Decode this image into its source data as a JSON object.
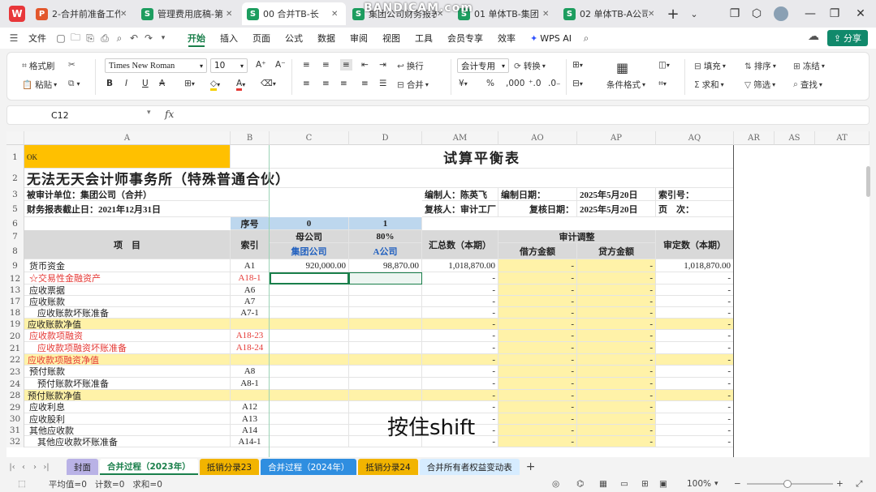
{
  "tabs": [
    {
      "icon": "P",
      "label": "2-合并前准备工作"
    },
    {
      "icon": "S",
      "label": "管理费用底稿-第"
    },
    {
      "icon": "S",
      "label": "00 合并TB-长"
    },
    {
      "icon": "S",
      "label": "集团公司财务报表"
    },
    {
      "icon": "S",
      "label": "01 单体TB-集团"
    },
    {
      "icon": "S",
      "label": "02 单体TB-A公司"
    }
  ],
  "watermark": "BANDICAM.com",
  "menu": [
    "文件",
    "开始",
    "插入",
    "页面",
    "公式",
    "数据",
    "审阅",
    "视图",
    "工具",
    "会员专享",
    "效率",
    "WPS AI"
  ],
  "share_label": "分享",
  "ribbon": {
    "format_painter": "格式刷",
    "paste": "粘贴",
    "font_name": "Times New Roman",
    "font_size": "10",
    "wrap": "换行",
    "merge": "合并",
    "number_format": "会计专用",
    "convert": "转换",
    "cond_format": "条件格式",
    "fill": "填充",
    "sort": "排序",
    "freeze": "冻结",
    "sum": "求和",
    "filter": "筛选",
    "find": "查找"
  },
  "namebox": "C12",
  "fx_label": "fx",
  "columns": [
    "A",
    "B",
    "C",
    "D",
    "AM",
    "AO",
    "AP",
    "AQ",
    "AR",
    "AS",
    "AT"
  ],
  "rows": [
    "1",
    "2",
    "3",
    "5",
    "6",
    "7",
    "8",
    "9",
    "12",
    "13",
    "17",
    "18",
    "19",
    "20",
    "21",
    "22",
    "23",
    "24",
    "28",
    "29",
    "30",
    "31",
    "32"
  ],
  "sheet": {
    "a1": "OK",
    "title": "试算平衡表",
    "firm": "无法无天会计师事务所（特殊普通合伙）",
    "audited_unit": "被审计单位：集团公司（合并）",
    "period": "财务报表截止日：2021年12月31日",
    "preparer": "编制人：陈英飞",
    "prep_date_label": "编制日期：",
    "prep_date": "2025年5月20日",
    "index_no": "索引号：",
    "reviewer": "复核人：审计工厂",
    "review_date_label": "复核日期：",
    "review_date": "2025年5月20日",
    "page_label": "页　次：",
    "seq_label": "序号",
    "seq_c": "0",
    "seq_d": "1",
    "item_header": "项　目",
    "index_header": "索引",
    "parent_label": "母公司",
    "ratio": "80%",
    "group_co": "集团公司",
    "a_co": "A公司",
    "total_label": "汇总数（本期）",
    "adjust_label": "审计调整",
    "debit_label": "借方金额",
    "credit_label": "贷方金额",
    "audited_label": "审定数（本期）"
  },
  "items": [
    {
      "row": "9",
      "name": "货币资金",
      "idx": "A1",
      "c": "920,000.00",
      "d": "98,870.00",
      "am": "1,018,870.00",
      "ao": "-",
      "ap": "-",
      "aq": "1,018,870.00",
      "style": "normal"
    },
    {
      "row": "12",
      "name": "☆交易性金融资产",
      "idx": "A18-1",
      "c": "",
      "d": "",
      "am": "-",
      "ao": "-",
      "ap": "-",
      "aq": "-",
      "style": "red"
    },
    {
      "row": "13",
      "name": "应收票据",
      "idx": "A6",
      "c": "",
      "d": "",
      "am": "-",
      "ao": "-",
      "ap": "-",
      "aq": "-",
      "style": "normal"
    },
    {
      "row": "17",
      "name": "应收账款",
      "idx": "A7",
      "c": "",
      "d": "",
      "am": "-",
      "ao": "-",
      "ap": "-",
      "aq": "-",
      "style": "normal"
    },
    {
      "row": "18",
      "name": "应收账款坏账准备",
      "idx": "A7-1",
      "c": "",
      "d": "",
      "am": "-",
      "ao": "-",
      "ap": "-",
      "aq": "-",
      "style": "indent"
    },
    {
      "row": "19",
      "name": "应收账款净值",
      "idx": "",
      "c": "",
      "d": "",
      "am": "-",
      "ao": "-",
      "ap": "-",
      "aq": "-",
      "style": "yellow"
    },
    {
      "row": "20",
      "name": "应收款项融资",
      "idx": "A18-23",
      "c": "",
      "d": "",
      "am": "-",
      "ao": "-",
      "ap": "-",
      "aq": "-",
      "style": "red"
    },
    {
      "row": "21",
      "name": "应收款项融资坏账准备",
      "idx": "A18-24",
      "c": "",
      "d": "",
      "am": "-",
      "ao": "-",
      "ap": "-",
      "aq": "-",
      "style": "redindent"
    },
    {
      "row": "22",
      "name": "应收款项融资净值",
      "idx": "",
      "c": "",
      "d": "",
      "am": "-",
      "ao": "-",
      "ap": "-",
      "aq": "-",
      "style": "yellowred"
    },
    {
      "row": "23",
      "name": "预付账款",
      "idx": "A8",
      "c": "",
      "d": "",
      "am": "-",
      "ao": "-",
      "ap": "-",
      "aq": "-",
      "style": "normal"
    },
    {
      "row": "24",
      "name": "预付账款坏账准备",
      "idx": "A8-1",
      "c": "",
      "d": "",
      "am": "-",
      "ao": "-",
      "ap": "-",
      "aq": "-",
      "style": "indent"
    },
    {
      "row": "28",
      "name": "预付账款净值",
      "idx": "",
      "c": "",
      "d": "",
      "am": "-",
      "ao": "-",
      "ap": "-",
      "aq": "-",
      "style": "yellow"
    },
    {
      "row": "29",
      "name": "应收利息",
      "idx": "A12",
      "c": "",
      "d": "",
      "am": "-",
      "ao": "-",
      "ap": "-",
      "aq": "-",
      "style": "normal"
    },
    {
      "row": "30",
      "name": "应收股利",
      "idx": "A13",
      "c": "",
      "d": "",
      "am": "-",
      "ao": "-",
      "ap": "-",
      "aq": "-",
      "style": "normal"
    },
    {
      "row": "31",
      "name": "其他应收款",
      "idx": "A14",
      "c": "",
      "d": "",
      "am": "-",
      "ao": "-",
      "ap": "-",
      "aq": "-",
      "style": "normal"
    },
    {
      "row": "32",
      "name": "其他应收款坏账准备",
      "idx": "A14-1",
      "c": "",
      "d": "",
      "am": "-",
      "ao": "-",
      "ap": "-",
      "aq": "-",
      "style": "indent"
    }
  ],
  "overlay": "按住shift",
  "sheet_tabs": [
    {
      "label": "封面",
      "color": "#b9b2e6"
    },
    {
      "label": "合并过程（2023年）",
      "color": "#ffffff"
    },
    {
      "label": "抵销分录23",
      "color": "#f2b400"
    },
    {
      "label": "合并过程（2024年）",
      "color": "#2f8ee0"
    },
    {
      "label": "抵销分录24",
      "color": "#f2b400"
    },
    {
      "label": "合并所有者权益变动表",
      "color": "#d6ecff"
    }
  ],
  "status": {
    "avg": "平均值=0",
    "count": "计数=0",
    "sum": "求和=0",
    "zoom": "100%"
  },
  "colors": {
    "accent": "#1a7f4b",
    "yellow_fill": "#fff2a8",
    "header_gray": "#d9d9d9",
    "ok_fill": "#ffc000",
    "blue_fill": "#bdd7ee",
    "red_text": "#e53935",
    "blue_text": "#1f5fbf"
  }
}
